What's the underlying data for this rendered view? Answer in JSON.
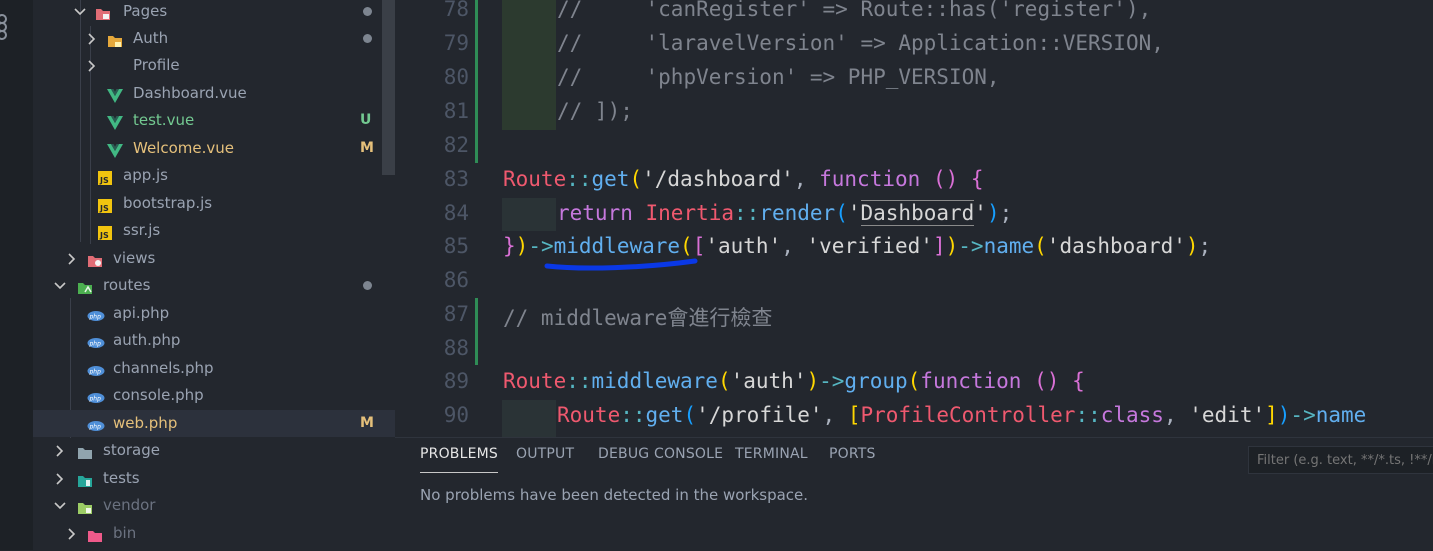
{
  "explorer": {
    "items": [
      {
        "label": "Pages",
        "color": "#e5c07b",
        "icon": "folder-pages-icon",
        "dot": true
      },
      {
        "label": "Auth",
        "color": "#e5c07b",
        "icon": "folder-lock-icon",
        "dot": true
      },
      {
        "label": "Profile",
        "color": "#9aa3b2",
        "icon": "none"
      },
      {
        "label": "Dashboard.vue",
        "color": "#9aa3b2",
        "icon": "vue-icon"
      },
      {
        "label": "test.vue",
        "color": "#73c991",
        "icon": "vue-icon",
        "badge": "U"
      },
      {
        "label": "Welcome.vue",
        "color": "#e5c07b",
        "icon": "vue-icon",
        "badge": "M"
      },
      {
        "label": "app.js",
        "color": "#9aa3b2",
        "icon": "js-icon"
      },
      {
        "label": "bootstrap.js",
        "color": "#9aa3b2",
        "icon": "js-icon"
      },
      {
        "label": "ssr.js",
        "color": "#9aa3b2",
        "icon": "js-icon"
      },
      {
        "label": "views",
        "color": "#9aa3b2",
        "icon": "folder-views-icon"
      },
      {
        "label": "routes",
        "color": "#9aa3b2",
        "icon": "folder-routes-icon",
        "dot": true
      },
      {
        "label": "api.php",
        "color": "#9aa3b2",
        "icon": "php-icon"
      },
      {
        "label": "auth.php",
        "color": "#9aa3b2",
        "icon": "php-icon"
      },
      {
        "label": "channels.php",
        "color": "#9aa3b2",
        "icon": "php-icon"
      },
      {
        "label": "console.php",
        "color": "#9aa3b2",
        "icon": "php-icon"
      },
      {
        "label": "web.php",
        "color": "#e5c07b",
        "icon": "php-icon",
        "badge": "M"
      },
      {
        "label": "storage",
        "color": "#9aa3b2",
        "icon": "folder-icon"
      },
      {
        "label": "tests",
        "color": "#9aa3b2",
        "icon": "folder-tests-icon"
      },
      {
        "label": "vendor",
        "color": "#6b7280",
        "icon": "folder-vendor-icon"
      },
      {
        "label": "bin",
        "color": "#6b7280",
        "icon": "folder-bin-icon"
      }
    ]
  },
  "editor": {
    "line_numbers": [
      "78",
      "79",
      "80",
      "81",
      "82",
      "83",
      "84",
      "85",
      "86",
      "87",
      "88",
      "89",
      "90"
    ],
    "code": {
      "l78a": "//     ",
      "l78b": "'canRegister' => Route::has('register'),",
      "l79a": "//     ",
      "l79b": "'laravelVersion' => Application::VERSION,",
      "l80a": "//     ",
      "l80b": "'phpVersion' => PHP_VERSION,",
      "l81": "// ]);",
      "route": "Route",
      "dcolon": "::",
      "get": "get",
      "lp": "(",
      "dash_str": "'/dashboard'",
      "comma": ", ",
      "function": "function",
      "parens": "()",
      "sp": " ",
      "lbrace": "{",
      "return": "return",
      "inertia": "Inertia",
      "render": "render",
      "q1": "'",
      "dashboard_word": "Dashboard",
      "q2": "'",
      "rp": ")",
      "semi": ";",
      "rbrace": "}",
      "arrow": "->",
      "middleware": "middleware",
      "lbr": "[",
      "auth_str": "'auth'",
      "verified_str": "'verified'",
      "rbr": "]",
      "name": "name",
      "dashboard_str": "'dashboard'",
      "comment87": "// middleware會進行檢查",
      "group": "group",
      "profile_str": "'/profile'",
      "profile_ctrl": "ProfileController",
      "class_kw": "class",
      "edit_str": "'edit'",
      "name_cut": "name"
    }
  },
  "panel": {
    "tabs": [
      "PROBLEMS",
      "OUTPUT",
      "DEBUG CONSOLE",
      "TERMINAL",
      "PORTS"
    ],
    "filter_placeholder": "Filter (e.g. text, **/*.ts, !**/n",
    "message": "No problems have been detected in the workspace."
  }
}
